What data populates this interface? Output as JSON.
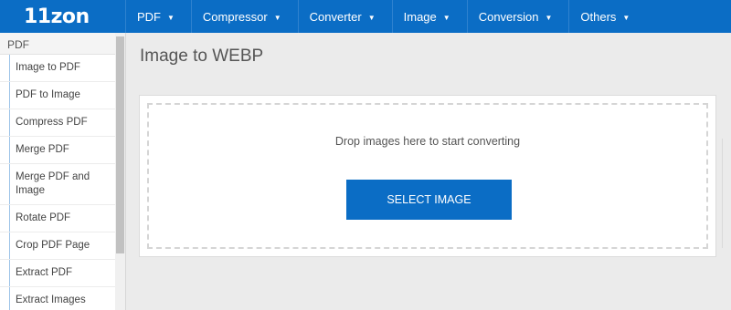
{
  "logo": "11zon",
  "nav": {
    "items": [
      {
        "label": "PDF"
      },
      {
        "label": "Compressor"
      },
      {
        "label": "Converter"
      },
      {
        "label": "Image"
      },
      {
        "label": "Conversion"
      },
      {
        "label": "Others"
      }
    ],
    "dropdown_icon": "chevron-down-icon"
  },
  "sidebar": {
    "header": "PDF",
    "items": [
      {
        "label": "Image to PDF"
      },
      {
        "label": "PDF to Image"
      },
      {
        "label": "Compress PDF"
      },
      {
        "label": "Merge PDF"
      },
      {
        "label": "Merge PDF and Image"
      },
      {
        "label": "Rotate PDF"
      },
      {
        "label": "Crop PDF Page"
      },
      {
        "label": "Extract PDF"
      },
      {
        "label": "Extract Images"
      }
    ]
  },
  "main": {
    "title": "Image to WEBP",
    "drop_text": "Drop images here to start converting",
    "select_button": "SELECT IMAGE"
  },
  "colors": {
    "brand": "#0b6dc5",
    "background": "#ebebeb"
  }
}
